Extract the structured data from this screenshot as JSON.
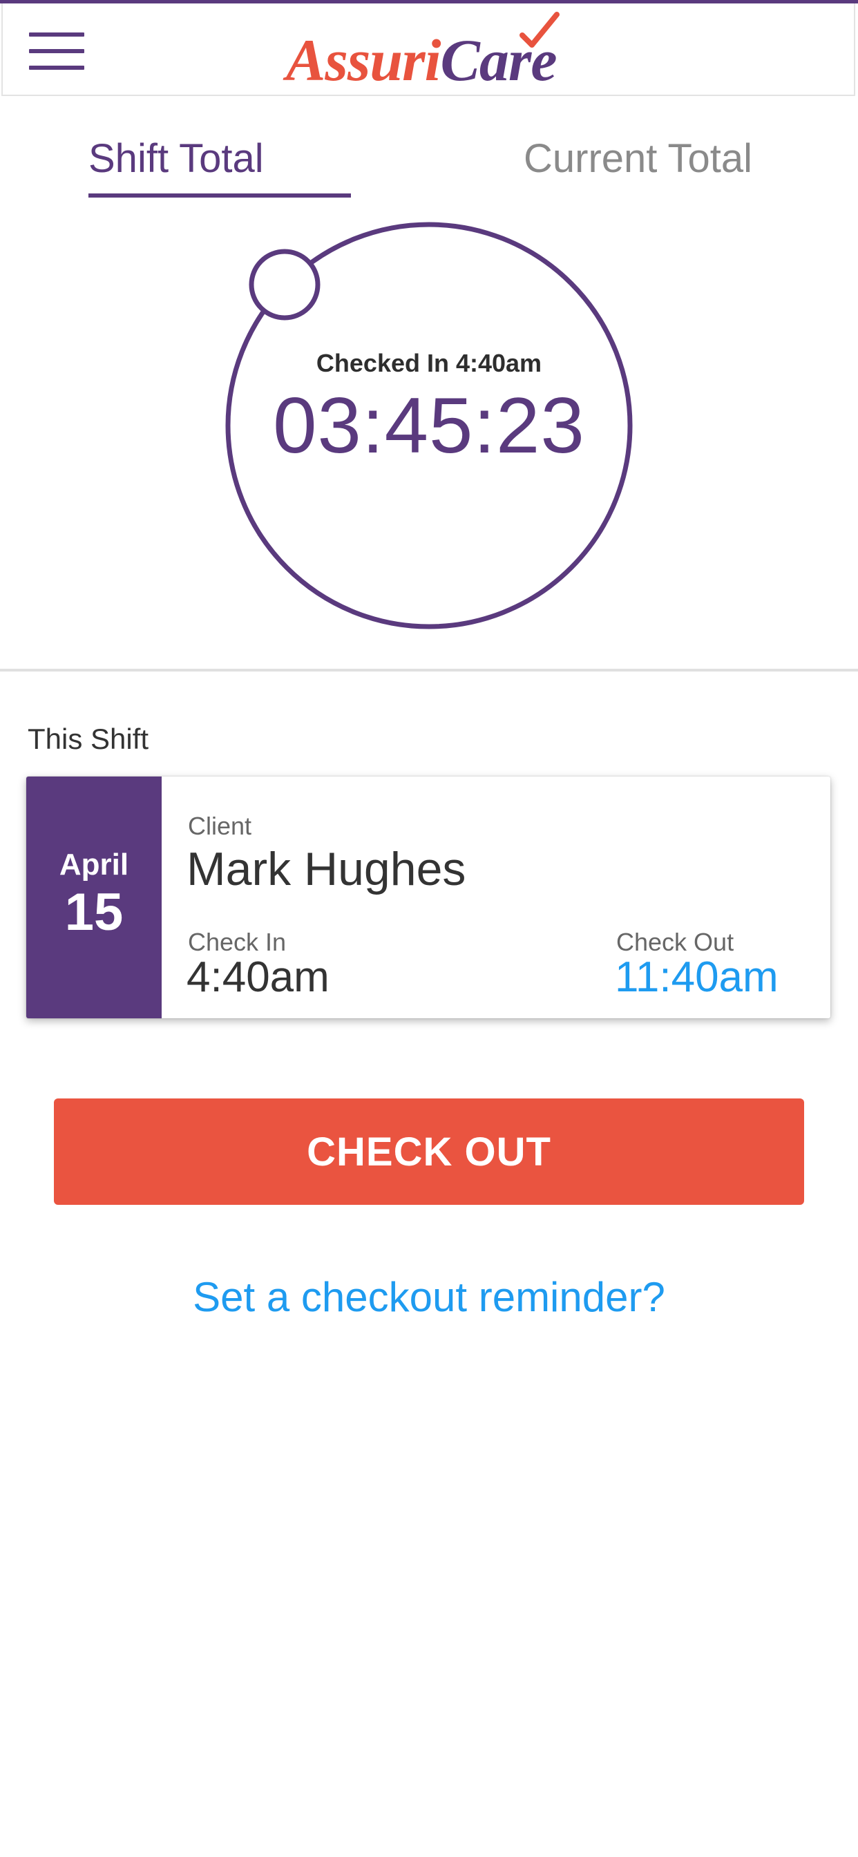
{
  "header": {
    "menu_icon": "hamburger-menu-icon",
    "logo": {
      "part1": "Assuri",
      "part2": "Care",
      "check_icon": "checkmark-icon"
    }
  },
  "tabs": [
    {
      "label": "Shift Total",
      "active": true
    },
    {
      "label": "Current Total",
      "active": false
    }
  ],
  "timer": {
    "checked_in_text": "Checked In 4:40am",
    "elapsed": "03:45:23"
  },
  "this_shift": {
    "section_label": "This Shift",
    "date": {
      "month": "April",
      "day": "15"
    },
    "client_label": "Client",
    "client_name": "Mark Hughes",
    "check_in_label": "Check In",
    "check_in_value": "4:40am",
    "check_out_label": "Check Out",
    "check_out_value": "11:40am"
  },
  "actions": {
    "check_out_button": "CHECK OUT",
    "reminder_link": "Set a checkout reminder?"
  },
  "colors": {
    "brand_purple": "#5a3a7e",
    "brand_orange": "#e8533e",
    "button_red": "#ea5440",
    "link_blue": "#1e9bf0"
  }
}
